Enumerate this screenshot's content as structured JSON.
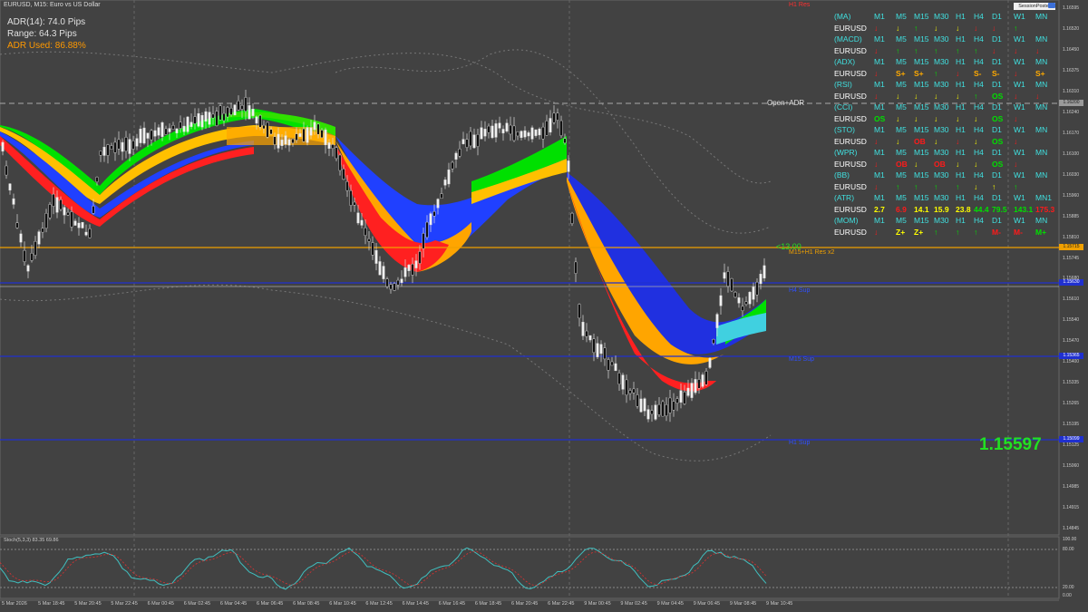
{
  "header": {
    "symbol_line": "EURUSD, M15:  Euro vs US Dollar",
    "adr_line": "ADR(14): 74.0 Pips",
    "range_line": "Range: 64.3 Pips",
    "adr_used_line": "ADR Used: 86.88%"
  },
  "sessions_button": "SessionPoster",
  "big_price": "1.15597",
  "levels": {
    "h1_res": "H1 Res",
    "open_adr": "Open+ADR",
    "m15_h1_res": "M15+H1 Res x2",
    "delta": "<13.00",
    "h4_sup": "H4 Sup",
    "m15_sup": "M15 Sup",
    "h1_sup": "H1 Sup"
  },
  "colors": {
    "background": "#424242",
    "up": "#00e000",
    "down": "#ff1a1a",
    "flat": "#ffff00",
    "cyan_label": "#40e0e0",
    "adr_orange": "#ff9900",
    "level_blue": "#2030d0",
    "level_orange": "#f0a000"
  },
  "indicator_table": {
    "timeframes": [
      "M1",
      "M5",
      "M15",
      "M30",
      "H1",
      "H4",
      "D1",
      "W1",
      "MN"
    ],
    "rows": [
      {
        "name": "(MA)",
        "symbol": "EURUSD",
        "cells": [
          [
            "↓",
            "#ff1a1a"
          ],
          [
            "↓",
            "#ffff00"
          ],
          [
            "↑",
            "#00e000"
          ],
          [
            "↓",
            "#ffff00"
          ],
          [
            "↓",
            "#ffff00"
          ],
          [
            "↓",
            "#ff1a1a"
          ],
          [
            "↓",
            "#ff1a1a"
          ],
          [
            "↑",
            "#00e000"
          ],
          [
            "",
            ""
          ]
        ]
      },
      {
        "name": "(MACD)",
        "symbol": "EURUSD",
        "cells": [
          [
            "↓",
            "#ff1a1a"
          ],
          [
            "↑",
            "#00e000"
          ],
          [
            "↑",
            "#00e000"
          ],
          [
            "↑",
            "#00e000"
          ],
          [
            "↑",
            "#00e000"
          ],
          [
            "↑",
            "#00e000"
          ],
          [
            "↓",
            "#ff1a1a"
          ],
          [
            "↓",
            "#ff1a1a"
          ],
          [
            "↓",
            "#ff1a1a"
          ]
        ]
      },
      {
        "name": "(ADX)",
        "symbol": "EURUSD",
        "cells": [
          [
            "↓",
            "#ff1a1a"
          ],
          [
            "S+",
            "#ffaa00"
          ],
          [
            "S+",
            "#ffaa00"
          ],
          [
            "↑",
            "#00e000"
          ],
          [
            "↓",
            "#ff1a1a"
          ],
          [
            "S-",
            "#ffaa00"
          ],
          [
            "S-",
            "#ffaa00"
          ],
          [
            "↓",
            "#ff1a1a"
          ],
          [
            "S+",
            "#ffaa00"
          ]
        ]
      },
      {
        "name": "(RSI)",
        "symbol": "EURUSD",
        "cells": [
          [
            "↓",
            "#ff1a1a"
          ],
          [
            "↓",
            "#ffff00"
          ],
          [
            "↓",
            "#ffff00"
          ],
          [
            "↓",
            "#ffff00"
          ],
          [
            "↓",
            "#ffff00"
          ],
          [
            "↑",
            "#00e000"
          ],
          [
            "OS",
            "#00e000"
          ],
          [
            "↓",
            "#ff1a1a"
          ],
          [
            "↓",
            "#ff1a1a"
          ]
        ]
      },
      {
        "name": "(CCI)",
        "symbol": "EURUSD",
        "cells": [
          [
            "OS",
            "#00e000"
          ],
          [
            "↓",
            "#ffff00"
          ],
          [
            "↓",
            "#ffff00"
          ],
          [
            "↓",
            "#ffff00"
          ],
          [
            "↓",
            "#ffff00"
          ],
          [
            "↓",
            "#ffff00"
          ],
          [
            "OS",
            "#00e000"
          ],
          [
            "↓",
            "#ff1a1a"
          ],
          [
            "",
            ""
          ]
        ]
      },
      {
        "name": "(STO)",
        "symbol": "EURUSD",
        "cells": [
          [
            "↓",
            "#ff1a1a"
          ],
          [
            "↓",
            "#ffff00"
          ],
          [
            "OB",
            "#ff1a1a"
          ],
          [
            "↓",
            "#ffff00"
          ],
          [
            "↓",
            "#ff1a1a"
          ],
          [
            "↓",
            "#ffff00"
          ],
          [
            "OS",
            "#00e000"
          ],
          [
            "↓",
            "#ff1a1a"
          ],
          [
            "",
            ""
          ]
        ]
      },
      {
        "name": "(WPR)",
        "symbol": "EURUSD",
        "cells": [
          [
            "↓",
            "#ff1a1a"
          ],
          [
            "OB",
            "#ff1a1a"
          ],
          [
            "↓",
            "#ffff00"
          ],
          [
            "OB",
            "#ff1a1a"
          ],
          [
            "↓",
            "#ffff00"
          ],
          [
            "↓",
            "#ffff00"
          ],
          [
            "OS",
            "#00e000"
          ],
          [
            "↓",
            "#ff1a1a"
          ],
          [
            "",
            ""
          ]
        ]
      },
      {
        "name": "(BB)",
        "symbol": "EURUSD",
        "cells": [
          [
            "↓",
            "#ff1a1a"
          ],
          [
            "↑",
            "#00e000"
          ],
          [
            "↑",
            "#00e000"
          ],
          [
            "↑",
            "#00e000"
          ],
          [
            "↑",
            "#00e000"
          ],
          [
            "↓",
            "#ffff00"
          ],
          [
            "↑",
            "#ffff00"
          ],
          [
            "↑",
            "#00e000"
          ],
          [
            "",
            ""
          ]
        ]
      },
      {
        "name": "(ATR)",
        "symbol": "EURUSD",
        "cells": [
          [
            "2.7",
            "#ffff00"
          ],
          [
            "6.9",
            "#ff1a1a"
          ],
          [
            "14.1",
            "#ffff00"
          ],
          [
            "15.9",
            "#ffff00"
          ],
          [
            "23.8",
            "#ffff00"
          ],
          [
            "44.4",
            "#00e000"
          ],
          [
            "79.5",
            "#00e000"
          ],
          [
            "143.1",
            "#00e000"
          ],
          [
            "175.3",
            "#ff1a1a"
          ]
        ],
        "mn_label": "MN1"
      },
      {
        "name": "(MOM)",
        "symbol": "EURUSD",
        "cells": [
          [
            "↓",
            "#ff1a1a"
          ],
          [
            "Z+",
            "#ffff00"
          ],
          [
            "Z+",
            "#ffff00"
          ],
          [
            "↑",
            "#00e000"
          ],
          [
            "↑",
            "#00e000"
          ],
          [
            "↑",
            "#00e000"
          ],
          [
            "M-",
            "#ff1a1a"
          ],
          [
            "M-",
            "#ff1a1a"
          ],
          [
            "M+",
            "#00e000"
          ]
        ]
      }
    ]
  },
  "price_axis": [
    "1.16595",
    "1.16520",
    "1.16450",
    "1.16375",
    "1.16310",
    "1.16240",
    "1.16170",
    "1.16100",
    "1.16030",
    "1.15960",
    "1.15885",
    "1.15810",
    "1.15745",
    "1.15680",
    "1.15610",
    "1.15540",
    "1.15470",
    "1.15400",
    "1.15335",
    "1.15265",
    "1.15195",
    "1.15125",
    "1.15060",
    "1.14985",
    "1.14915",
    "1.14845"
  ],
  "price_boxes": {
    "open_adr": "1.16200",
    "orange": "1.15715",
    "blue_top": "1.15630",
    "blue_mid": "1.15365",
    "blue_low": "1.15099"
  },
  "time_axis": [
    "5 Mar 2026",
    "5 Mar 18:45",
    "5 Mar 20:45",
    "5 Mar 22:45",
    "6 Mar 00:45",
    "6 Mar 02:45",
    "6 Mar 04:45",
    "6 Mar 06:45",
    "6 Mar 08:45",
    "6 Mar 10:45",
    "6 Mar 12:45",
    "6 Mar 14:45",
    "6 Mar 16:45",
    "6 Mar 18:45",
    "6 Mar 20:45",
    "6 Mar 22:45",
    "9 Mar 00:45",
    "9 Mar 02:45",
    "9 Mar 04:45",
    "9 Mar 06:45",
    "9 Mar 08:45",
    "9 Mar 10:45"
  ],
  "stoch": {
    "title": "Stoch(5,3,3) 83.35 69.86",
    "level_top": "100.00",
    "level_80": "80.00",
    "level_20": "20.00",
    "level_bottom": "0.00"
  }
}
